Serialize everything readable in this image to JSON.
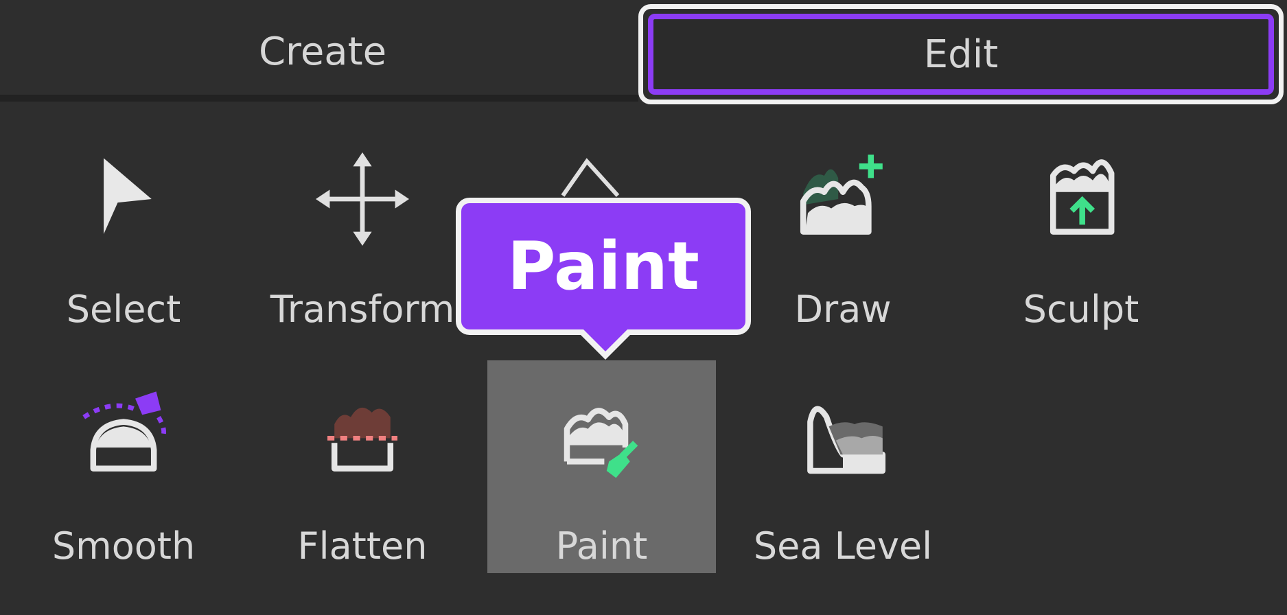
{
  "tabs": [
    {
      "label": "Create",
      "active": false
    },
    {
      "label": "Edit",
      "active": true
    }
  ],
  "tools": [
    {
      "label": "Select",
      "icon": "cursor-icon"
    },
    {
      "label": "Transform",
      "icon": "move-arrows-icon"
    },
    {
      "label": "Draw",
      "icon": "terrain-add-icon"
    },
    {
      "label": "Sculpt",
      "icon": "terrain-sculpt-icon"
    },
    {
      "label": "Smooth",
      "icon": "terrain-smooth-icon"
    },
    {
      "label": "Flatten",
      "icon": "terrain-flatten-icon"
    },
    {
      "label": "Paint",
      "icon": "terrain-paint-icon",
      "selected": true
    },
    {
      "label": "Sea Level",
      "icon": "sea-level-icon"
    }
  ],
  "tooltip": {
    "text": "Paint"
  },
  "colors": {
    "accent": "#8c3cf5",
    "background": "#2e2e2e",
    "selected": "#6a6a6a",
    "green": "#3fe08a"
  }
}
